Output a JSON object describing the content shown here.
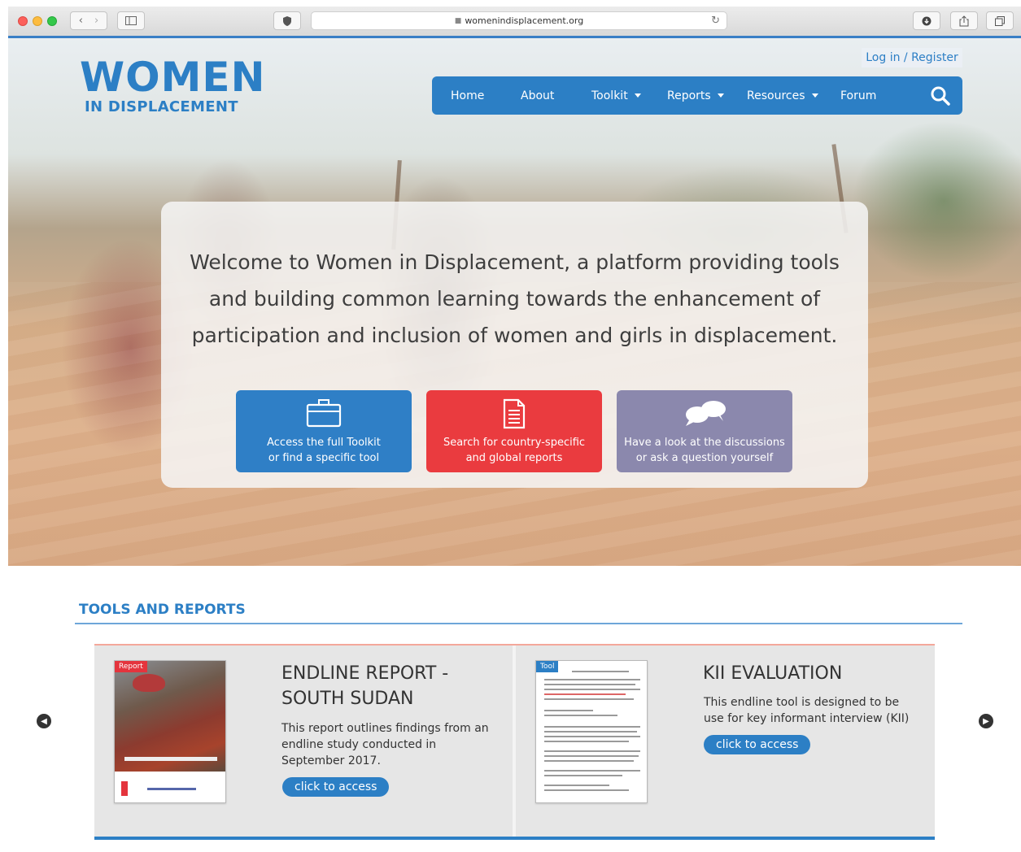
{
  "browser": {
    "url": "womenindisplacement.org"
  },
  "header": {
    "logo_top": "WOMEN",
    "logo_bottom": "IN DISPLACEMENT",
    "login_label": "Log in / Register"
  },
  "nav": {
    "items": [
      {
        "label": "Home"
      },
      {
        "label": "About"
      },
      {
        "label": "Toolkit"
      },
      {
        "label": "Reports"
      },
      {
        "label": "Resources"
      },
      {
        "label": "Forum"
      }
    ]
  },
  "hero": {
    "welcome": "Welcome to Women in Displacement, a platform providing tools and building common learning towards the enhancement of participation and inclusion of women and girls in displacement.",
    "cta": [
      {
        "line1": "Access the full Toolkit",
        "line2": "or find a specific tool",
        "color": "#2f7fc6",
        "icon": "toolbox-icon"
      },
      {
        "line1": "Search for country-specific",
        "line2": "and global reports",
        "color": "#ea3b3f",
        "icon": "document-icon"
      },
      {
        "line1": "Have a look at the discussions",
        "line2": "or ask a question yourself",
        "color": "#8b88ad",
        "icon": "chat-bubbles-icon"
      }
    ]
  },
  "tools": {
    "section_title": "TOOLS AND REPORTS",
    "cards": [
      {
        "tag": "Report",
        "title_line1": "ENDLINE REPORT -",
        "title_line2": "SOUTH SUDAN",
        "desc_line1": "This report outlines findings from an",
        "desc_line2": "endline study conducted in",
        "desc_line3": "September 2017.",
        "button": "click to access"
      },
      {
        "tag": "Tool",
        "title_line1": "KII EVALUATION",
        "desc_line1": "This endline tool is designed to be",
        "desc_line2": "use for key informant interview (KII)",
        "button": "click to access"
      }
    ]
  },
  "colors": {
    "brand_blue": "#2c7fc5",
    "report_red": "#ea3b3f",
    "forum_purple": "#8b88ad"
  }
}
